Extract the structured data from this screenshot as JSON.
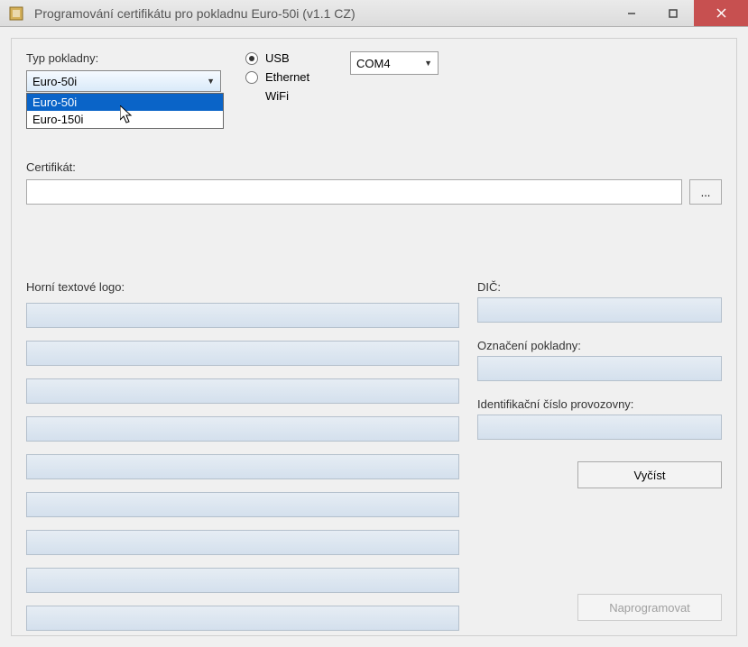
{
  "window": {
    "title": "Programování certifikátu pro pokladnu Euro-50i (v1.1 CZ)",
    "min": "—",
    "max": "▢",
    "close": "✕"
  },
  "type_section": {
    "label": "Typ pokladny:",
    "selected": "Euro-50i",
    "options": [
      "Euro-50i",
      "Euro-150i"
    ]
  },
  "connection": {
    "usb": "USB",
    "ethernet": "Ethernet",
    "wifi": "WiFi"
  },
  "port": {
    "selected": "COM4"
  },
  "cert": {
    "label": "Certifikát:",
    "browse": "..."
  },
  "logo": {
    "label": "Horní textové logo:"
  },
  "dic": {
    "label": "DIČ:"
  },
  "oznaceni": {
    "label": "Označení pokladny:"
  },
  "idprov": {
    "label": "Identifikační číslo provozovny:"
  },
  "buttons": {
    "read": "Vyčíst",
    "program": "Naprogramovat"
  }
}
